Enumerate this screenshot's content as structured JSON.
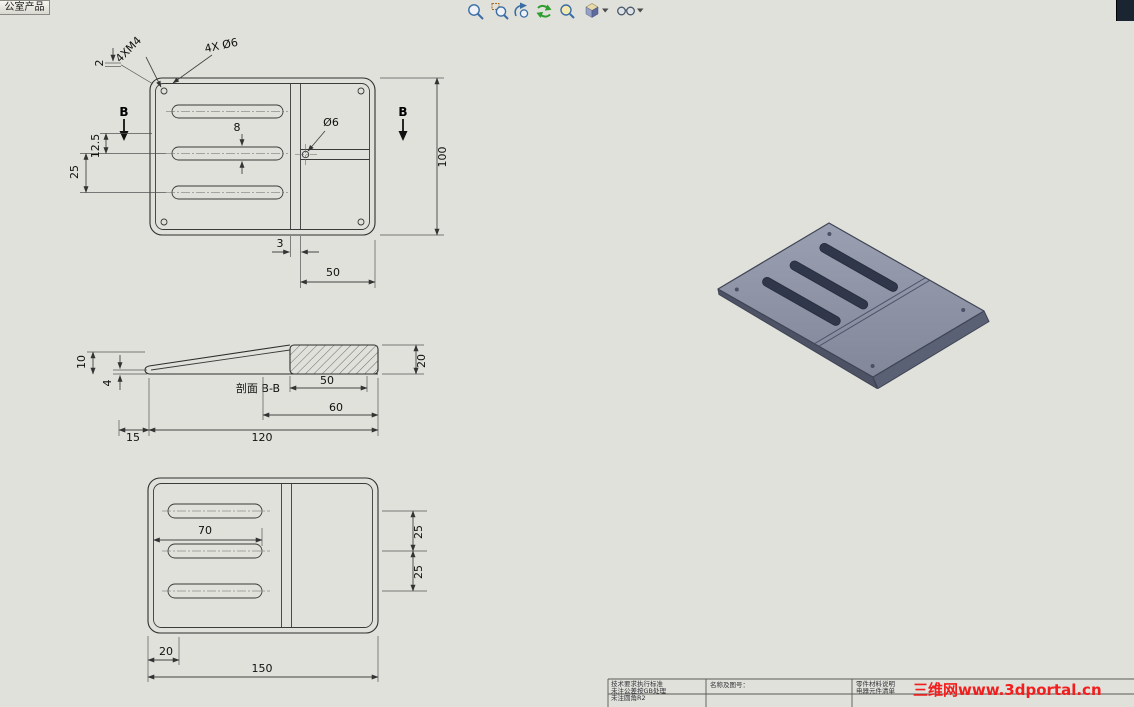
{
  "app": {
    "tab_label": "公室产品",
    "background": "#e0e1da",
    "watermark": "三维网www.3dportal.cn",
    "watermark_color": "#f21d1d"
  },
  "toolbar": {
    "icon_names": [
      "zoom-to-fit",
      "zoom-to-area",
      "zoom-previous",
      "rebuild",
      "zoom-selected",
      "view-orientation",
      "display-style"
    ]
  },
  "drawing": {
    "top_view": {
      "note_tapped_holes": "4XM4",
      "note_drilled_holes": "4X Ø6",
      "dim_edge_offset": "2",
      "section_label_left": "B",
      "section_label_right": "B",
      "dim_slot_pitch": "25",
      "dim_half_pitch": "12.5",
      "dim_slot_width": "8",
      "dim_hole": "Ø6",
      "dim_height": "100",
      "dim_rib": "3",
      "dim_right_width": "50"
    },
    "section_view": {
      "label": "剖面 B-B",
      "dim_tip_height": "10",
      "dim_wall": "4",
      "dim_block": "50",
      "dim_thickness": "20",
      "dim_left_offset": "15",
      "dim_length": "120",
      "dim_right_span": "60"
    },
    "bottom_view": {
      "dim_slot_length": "70",
      "dim_pitch_upper": "25",
      "dim_pitch_lower": "25",
      "dim_offset": "20",
      "dim_width": "150"
    }
  },
  "title_block": {
    "left_rows": [
      "技术要求执行标准",
      "未注公差按GB处理",
      "未注圆角R2"
    ],
    "name_label": "名称及图号：",
    "right_rows": [
      "零件材料说明",
      "电器元件清单"
    ]
  }
}
